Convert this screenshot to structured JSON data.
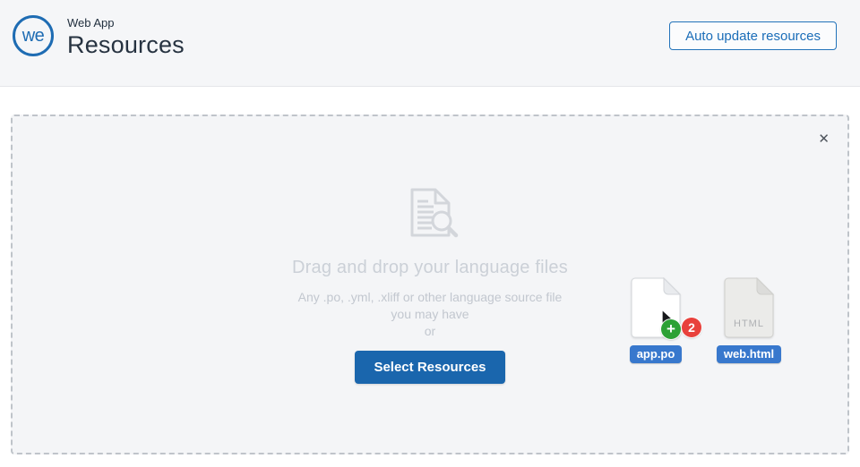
{
  "header": {
    "logo_text": "we",
    "app_subtitle": "Web App",
    "title": "Resources",
    "auto_update_button": "Auto update resources"
  },
  "dropzone": {
    "close_symbol": "✕",
    "heading": "Drag and drop your language files",
    "subtext_line1": "Any .po, .yml, .xliff or other language source file",
    "subtext_line2": "you may have",
    "separator_text": "or",
    "select_button": "Select Resources"
  },
  "files": [
    {
      "name": "app.po",
      "add_symbol": "+",
      "badge_count": "2"
    },
    {
      "name": "web.html",
      "type_marker": "HTML"
    }
  ],
  "colors": {
    "accent_blue": "#1e6cb3",
    "primary_button_blue": "#1a66ad",
    "file_label_blue": "#3878cd",
    "badge_green": "#2da135",
    "badge_red": "#e8413c",
    "dropzone_background": "#f4f5f7",
    "dropzone_border": "#bfc4ca",
    "muted_text": "#c2c7cf"
  }
}
